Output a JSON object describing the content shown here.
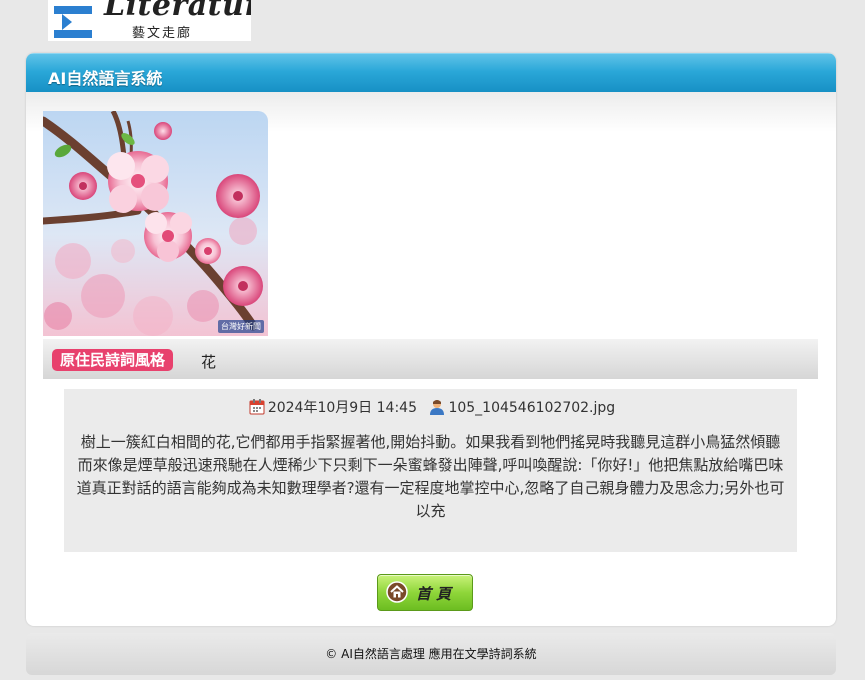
{
  "logo": {
    "text": "Literature",
    "subtitle": "藝文走廊"
  },
  "panel": {
    "title": "AI自然語言系統"
  },
  "photo": {
    "icon": "cherry-blossom-photo",
    "watermark": "台灣好新聞"
  },
  "style": {
    "tag": "原住民詩詞風格",
    "word": "花"
  },
  "entry": {
    "date": "2024年10月9日 14:45",
    "filename": "105_104546102702.jpg",
    "text": "樹上一簇紅白相間的花,它們都用手指緊握著他,開始抖動。如果我看到牠們搖晃時我聽見這群小鳥猛然傾聽而來像是煙草般迅速飛馳在人煙稀少下只剩下一朵蜜蜂發出陣聲,呼叫喚醒說:「你好!」他把焦點放給嘴巴味道真正對話的語言能夠成為未知數理學者?還有一定程度地掌控中心,忽略了自己親身體力及思念力;另外也可以充"
  },
  "buttons": {
    "home_label": "首頁"
  },
  "footer": {
    "text": "© AI自然語言處理 應用在文學詩詞系統"
  },
  "colors": {
    "header_blue": "#2aa7d8",
    "tag_pink": "#e8416d",
    "button_green": "#8fd63a"
  }
}
